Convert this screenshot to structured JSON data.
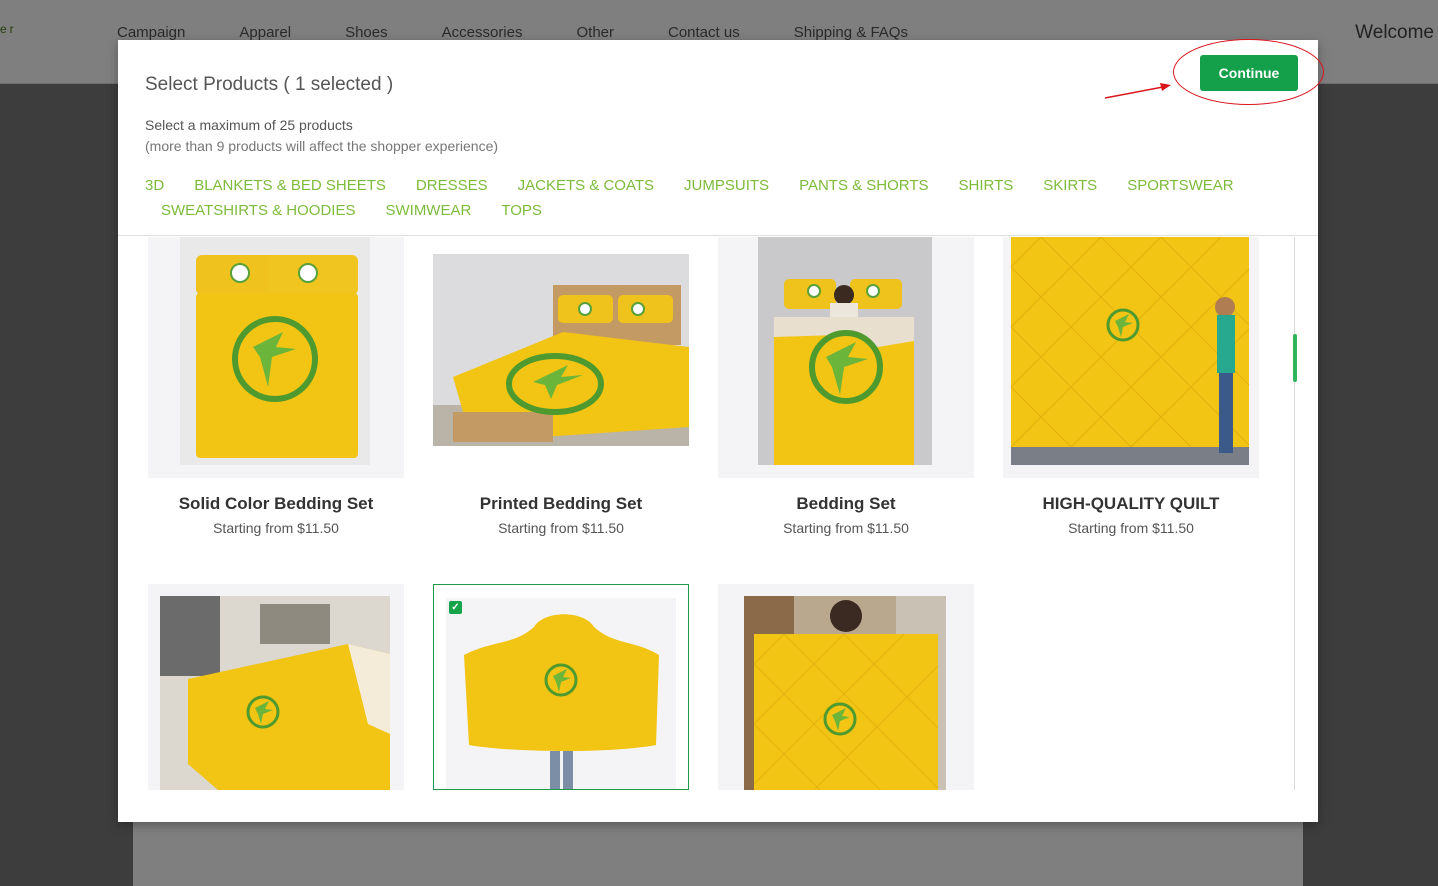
{
  "site": {
    "logo": "er",
    "nav": [
      "Campaign",
      "Apparel",
      "Shoes",
      "Accessories",
      "Other",
      "Contact us",
      "Shipping & FAQs"
    ],
    "welcome": "Welcome"
  },
  "modal": {
    "title": "Select Products ( 1 selected )",
    "subtitle1": "Select a maximum of 25 products",
    "subtitle2": "(more than 9 products will affect the shopper experience)",
    "continue_label": "Continue",
    "categories_row1": [
      "3D",
      "BLANKETS & BED SHEETS",
      "DRESSES",
      "JACKETS & COATS",
      "JUMPSUITS",
      "PANTS & SHORTS",
      "SHIRTS",
      "SKIRTS",
      "SPORTSWEAR"
    ],
    "categories_row2": [
      "SWEATSHIRTS & HOODIES",
      "SWIMWEAR",
      "TOPS"
    ]
  },
  "products": [
    {
      "name": "Solid Color Bedding Set",
      "price": "Starting from $11.50",
      "selected": false
    },
    {
      "name": "Printed Bedding Set",
      "price": "Starting from $11.50",
      "selected": false
    },
    {
      "name": "Bedding Set",
      "price": "Starting from $11.50",
      "selected": false
    },
    {
      "name": "HIGH-QUALITY QUILT",
      "price": "Starting from $11.50",
      "selected": false
    },
    {
      "name": "",
      "price": "",
      "selected": false
    },
    {
      "name": "",
      "price": "",
      "selected": true
    },
    {
      "name": "",
      "price": "",
      "selected": false
    }
  ],
  "colors": {
    "accent_green": "#14a04a",
    "category_green": "#7dbb3a",
    "product_yellow": "#f2c414",
    "annotation_red": "#d9141b"
  },
  "icons": [
    "checkbox-checked-icon",
    "brand-logo-icon",
    "arrow-annotation-icon"
  ]
}
